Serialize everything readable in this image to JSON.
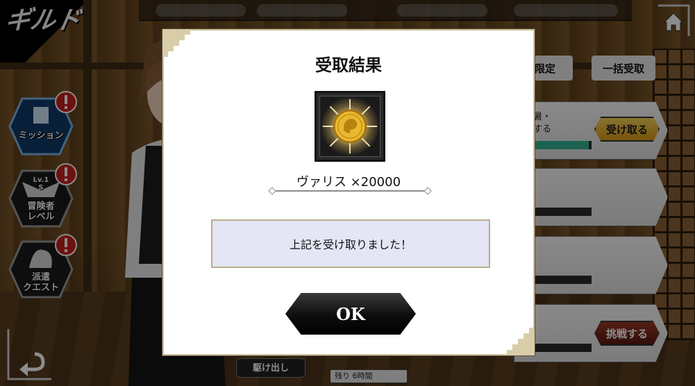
{
  "screen": {
    "title": "ギルド"
  },
  "top_bar": {
    "home_icon": "home-icon"
  },
  "side_nav": [
    {
      "id": "mission",
      "label": "ミッション",
      "icon": "mission-icon",
      "alert": "!"
    },
    {
      "id": "adventurer-level",
      "label": "冒険者\nレベル",
      "badge": "Lv.1 S",
      "icon": "wing-badge-icon",
      "alert": "!"
    },
    {
      "id": "dispatch-quest",
      "label": "派遣\nクエスト",
      "icon": "dispatch-icon",
      "alert": "!"
    }
  ],
  "right_panel": {
    "limited_tab": "限定",
    "bulk_receive": "一括受取",
    "card1_text_line1": "暑・",
    "card1_text_line2": "する",
    "card1_progress": 0.95,
    "receive_button": "受け取る",
    "challenge_button": "挑戦する",
    "remaining": "残り 6時間",
    "dispatch_button": "駆け出し"
  },
  "dialog": {
    "title": "受取結果",
    "reward_icon": "gold-coin-icon",
    "reward_name": "ヴァリス ×20000",
    "message": "上記を受け取りました！",
    "ok_label": "OK"
  },
  "colors": {
    "dialog_bg": "#ffffff",
    "message_bg": "#e4e6f5",
    "button_dark": "#0d0d0d",
    "gold": "#e8b830",
    "progress_fill": "#34b392",
    "challenge_red": "#7a2418"
  }
}
